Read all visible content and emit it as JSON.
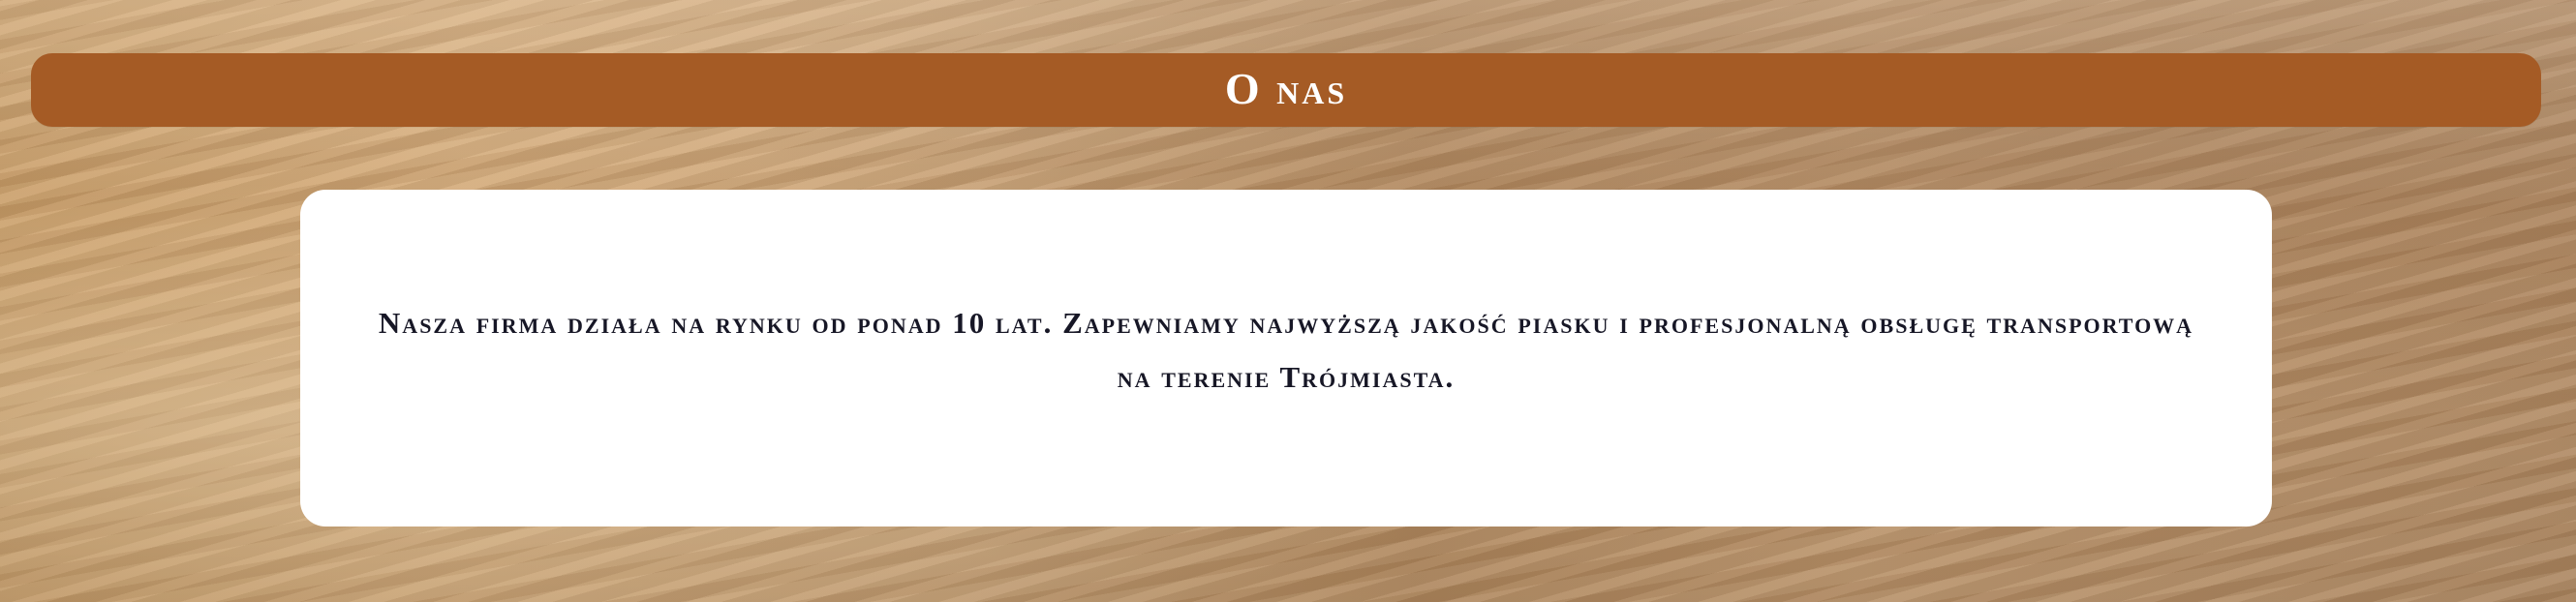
{
  "page": {
    "background_name": "sand-dunes-background",
    "accent_color": "#a55b25"
  },
  "header": {
    "title": "O nas"
  },
  "about": {
    "text": "Nasza firma działa na rynku od ponad 10 lat. Zapewniamy najwyższą jakość piasku i profesjonalną obsługę transportową na terenie Trójmiasta."
  }
}
